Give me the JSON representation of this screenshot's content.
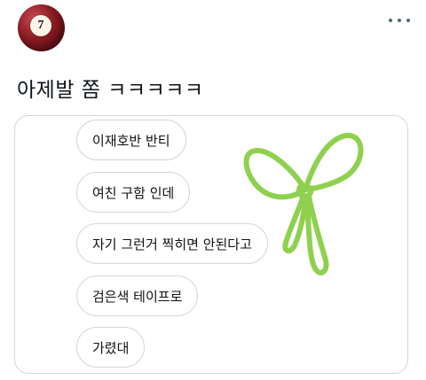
{
  "author": {
    "avatar_number": "7",
    "avatar_color": "#8a1b22"
  },
  "post": {
    "text": "아제발 쫌 ㅋㅋㅋㅋㅋ"
  },
  "image": {
    "messages": [
      "이재호반 반티",
      "여친 구함 인데",
      "자기 그런거 찍히면 안된다고",
      "검은색 테이프로",
      "가렸대"
    ],
    "bow_color": "#8fd14f",
    "bow_icon": "ribbon-bow-doodle"
  }
}
